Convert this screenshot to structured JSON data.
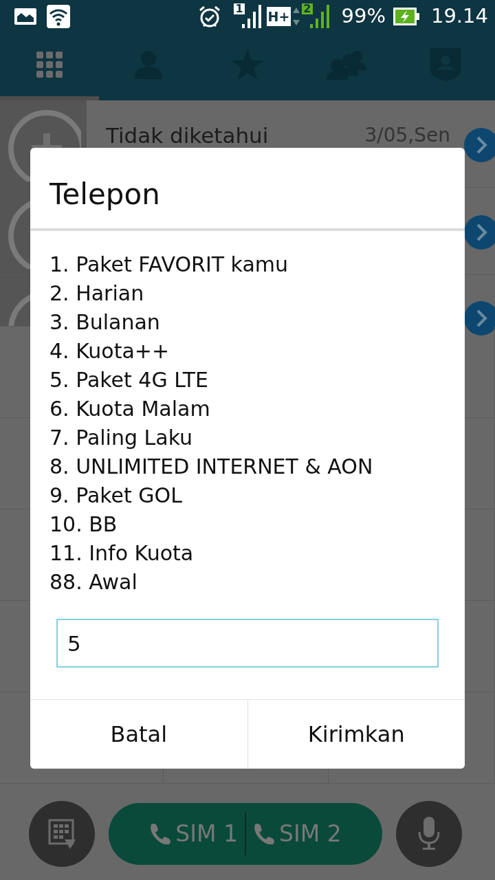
{
  "status_bar": {
    "battery": "99%",
    "time": "19.14",
    "sim_slots": [
      {
        "label": "1"
      },
      {
        "label": "2"
      }
    ],
    "network_type": "H+"
  },
  "tabs": [
    {
      "kind": "dialpad",
      "selected": true
    },
    {
      "kind": "contact",
      "selected": false
    },
    {
      "kind": "favorite",
      "selected": false
    },
    {
      "kind": "group",
      "selected": false
    },
    {
      "kind": "profile",
      "selected": false
    }
  ],
  "call_log": [
    {
      "name": "Tidak diketahui",
      "date": "3/05,Sen"
    }
  ],
  "dialog": {
    "title": "Telepon",
    "items": [
      "1. Paket FAVORIT kamu",
      "2. Harian",
      "3. Bulanan",
      "4. Kuota++",
      "5. Paket 4G LTE",
      "6. Kuota Malam",
      "7. Paling Laku",
      "8. UNLIMITED INTERNET & AON",
      "9. Paket GOL",
      "10. BB",
      "11. Info Kuota",
      "88. Awal"
    ],
    "input": {
      "value": "5"
    },
    "buttons": [
      "Batal",
      "Kirimkan"
    ]
  },
  "call_buttons": [
    "SIM 1",
    "SIM 2"
  ]
}
